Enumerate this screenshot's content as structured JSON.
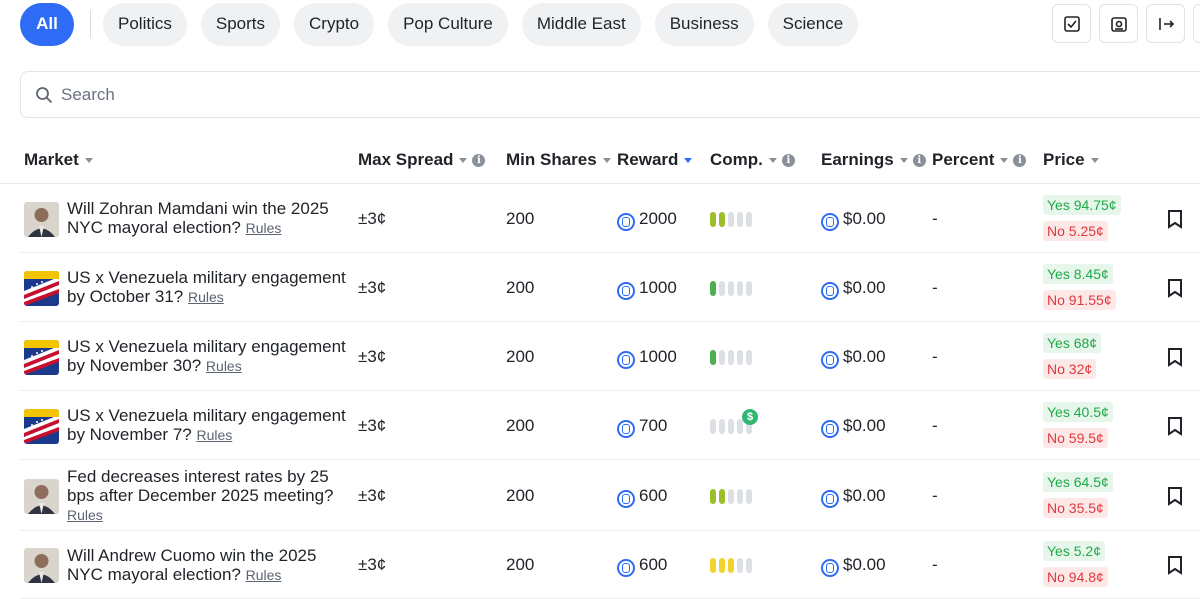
{
  "categories": [
    "All",
    "Politics",
    "Sports",
    "Crypto",
    "Pop Culture",
    "Middle East",
    "Business",
    "Science"
  ],
  "top_actions": [
    "checklist-icon",
    "report-icon",
    "logout-icon"
  ],
  "search": {
    "placeholder": "Search"
  },
  "columns": {
    "market": "Market",
    "max_spread": "Max Spread",
    "min_shares": "Min Shares",
    "reward": "Reward",
    "comp": "Comp.",
    "earnings": "Earnings",
    "percent": "Percent",
    "price": "Price"
  },
  "rules_label": "Rules",
  "colors": {
    "accent": "#2f6cf6",
    "yes": "#20a84a",
    "no": "#e0383e"
  },
  "rows": [
    {
      "title": "Will Zohran Mamdani win the 2025 NYC mayoral election?",
      "spread": "±3¢",
      "shares": "200",
      "reward": "2000",
      "comp": 2,
      "comp_color": "green-light",
      "earnings": "$0.00",
      "percent": "-",
      "yes": "Yes 94.75¢",
      "no": "No 5.25¢",
      "avatar": "person"
    },
    {
      "title": "US x Venezuela military engagement by October 31?",
      "spread": "±3¢",
      "shares": "200",
      "reward": "1000",
      "comp": 1,
      "comp_color": "green",
      "earnings": "$0.00",
      "percent": "-",
      "yes": "Yes 8.45¢",
      "no": "No 91.55¢",
      "avatar": "flag"
    },
    {
      "title": "US x Venezuela military engagement by November 30?",
      "spread": "±3¢",
      "shares": "200",
      "reward": "1000",
      "comp": 1,
      "comp_color": "green",
      "earnings": "$0.00",
      "percent": "-",
      "yes": "Yes 68¢",
      "no": "No 32¢",
      "avatar": "flag"
    },
    {
      "title": "US x Venezuela military engagement by November 7?",
      "spread": "±3¢",
      "shares": "200",
      "reward": "700",
      "comp": 0,
      "comp_color": "none",
      "earnings": "$0.00",
      "percent": "-",
      "yes": "Yes 40.5¢",
      "no": "No 59.5¢",
      "avatar": "flag",
      "badge": "$"
    },
    {
      "title": "Fed decreases interest rates by 25 bps after December 2025 meeting?",
      "spread": "±3¢",
      "shares": "200",
      "reward": "600",
      "comp": 2,
      "comp_color": "green-light",
      "earnings": "$0.00",
      "percent": "-",
      "yes": "Yes 64.5¢",
      "no": "No 35.5¢",
      "avatar": "person"
    },
    {
      "title": "Will Andrew Cuomo win the 2025 NYC mayoral election?",
      "spread": "±3¢",
      "shares": "200",
      "reward": "600",
      "comp": 3,
      "comp_color": "yellow",
      "earnings": "$0.00",
      "percent": "-",
      "yes": "Yes 5.2¢",
      "no": "No 94.8¢",
      "avatar": "person"
    }
  ]
}
